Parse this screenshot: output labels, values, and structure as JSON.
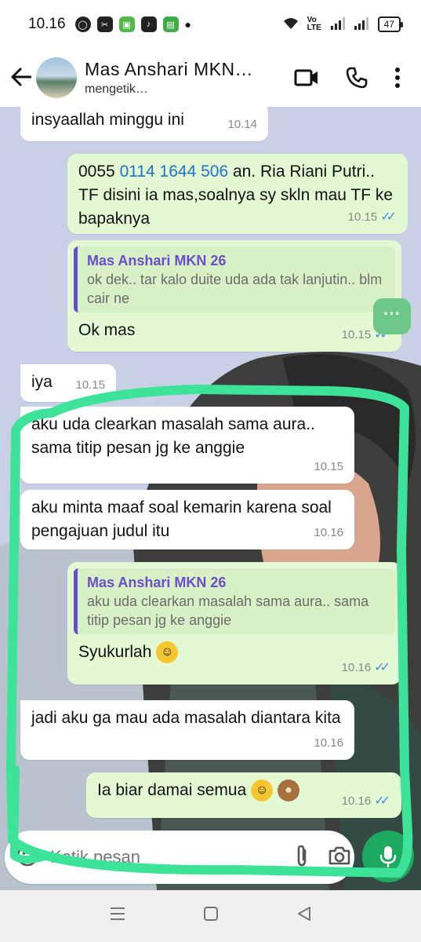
{
  "status_bar": {
    "time": "10.16",
    "network": "Vo LTE",
    "battery": "47"
  },
  "header": {
    "contact_name": "Mas Anshari MKN…",
    "status": "mengetik…"
  },
  "messages": [
    {
      "text": "insyaallah minggu ini",
      "time": "10.14"
    },
    {
      "prefix": "0055 ",
      "link": "0114 1644 506",
      "text_rest": " an. Ria Riani Putri.. TF disini ia mas,soalnya sy skln mau TF ke bapaknya",
      "time": "10.15"
    },
    {
      "quote_name": "Mas Anshari MKN 26",
      "quote_text": "ok dek.. tar kalo duite uda ada tak lanjutin.. blm cair ne",
      "text": "Ok mas",
      "time": "10.15"
    },
    {
      "text": "iya",
      "time": "10.15"
    },
    {
      "text": "aku uda clearkan masalah sama aura.. sama titip pesan jg ke anggie",
      "time": "10.15"
    },
    {
      "text": "aku minta maaf soal kemarin karena soal pengajuan judul itu",
      "time": "10.16"
    },
    {
      "quote_name": "Mas Anshari MKN 26",
      "quote_text": "aku uda clearkan masalah sama aura.. sama titip pesan jg ke anggie",
      "text": "Syukurlah",
      "time": "10.16"
    },
    {
      "text": "jadi aku ga mau ada masalah diantara kita",
      "time": "10.16"
    },
    {
      "text": "Ia biar damai semua",
      "time": "10.16"
    }
  ],
  "input": {
    "placeholder": "Ketik pesan"
  },
  "icons": {
    "back": "arrow-left-icon",
    "video": "video-camera-icon",
    "call": "phone-icon",
    "menu": "kebab-menu-icon",
    "emoji": "emoji-icon",
    "attach": "paperclip-icon",
    "camera": "camera-icon",
    "mic": "microphone-icon"
  },
  "colors": {
    "outgoing_bubble": "#e3f9d3",
    "incoming_bubble": "#ffffff",
    "read_ticks": "#3f8fe6",
    "quote_accent": "#6a4fc8",
    "mic_button": "#1da960",
    "marker_annotation": "#3ee39a"
  }
}
